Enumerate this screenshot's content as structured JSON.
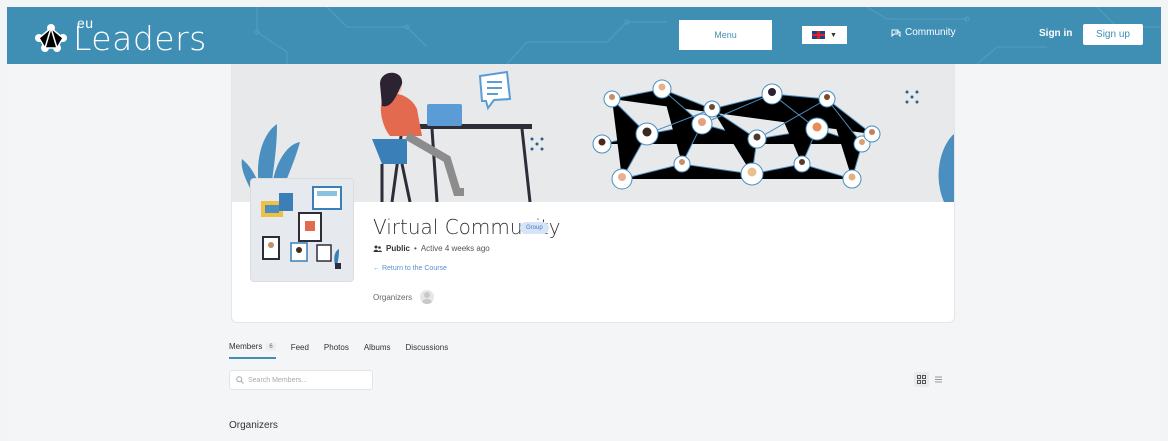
{
  "header": {
    "logo_prefix": "eu",
    "logo_text": "Leaders",
    "menu_label": "Menu",
    "language_flag": "uk-flag-icon",
    "community_label": "Community",
    "signin_label": "Sign in",
    "signup_label": "Sign up",
    "bg_color": "#3f8fb5"
  },
  "group": {
    "title": "Virtual Community",
    "badge": "Group",
    "visibility": "Public",
    "activity": "Active 4 weeks ago",
    "return_link": "Return to the Course",
    "organizers_label": "Organizers"
  },
  "tabs": [
    {
      "label": "Members",
      "count": "6"
    },
    {
      "label": "Feed"
    },
    {
      "label": "Photos"
    },
    {
      "label": "Albums"
    },
    {
      "label": "Discussions"
    }
  ],
  "search": {
    "placeholder": "Search Members..."
  },
  "sections": {
    "organizers_heading": "Organizers"
  }
}
